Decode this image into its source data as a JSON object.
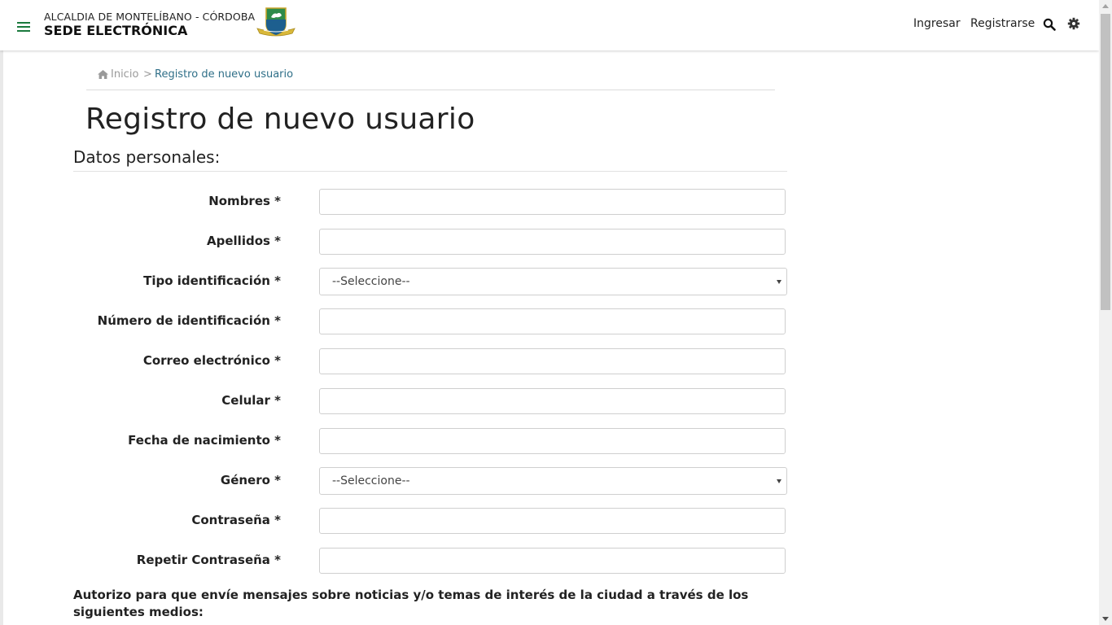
{
  "header": {
    "brand_top": "ALCALDIA DE MONTELÍBANO - CÓRDOBA",
    "brand_main": "SEDE ELECTRÓNICA",
    "nav": {
      "login": "Ingresar",
      "register": "Registrarse"
    },
    "accent_color": "#1b7a3e"
  },
  "breadcrumb": {
    "home": "Inicio",
    "separator": ">",
    "current": "Registro de nuevo usuario"
  },
  "page": {
    "title": "Registro de nuevo usuario",
    "section_title": "Datos personales:"
  },
  "form": {
    "nombres": {
      "label": "Nombres *",
      "value": ""
    },
    "apellidos": {
      "label": "Apellidos *",
      "value": ""
    },
    "tipo_identificacion": {
      "label": "Tipo identificación *",
      "selected": "--Seleccione--"
    },
    "numero_identificacion": {
      "label": "Número de identificación *",
      "value": ""
    },
    "correo": {
      "label": "Correo electrónico *",
      "value": ""
    },
    "celular": {
      "label": "Celular *",
      "value": ""
    },
    "fecha_nacimiento": {
      "label": "Fecha de nacimiento *",
      "value": ""
    },
    "genero": {
      "label": "Género *",
      "selected": "--Seleccione--"
    },
    "contrasena": {
      "label": "Contraseña *",
      "value": ""
    },
    "repetir_contrasena": {
      "label": "Repetir Contraseña *",
      "value": ""
    }
  },
  "consent": {
    "text": "Autorizo para que envíe mensajes sobre noticias y/o temas de interés de la ciudad a través de los siguientes medios:"
  }
}
